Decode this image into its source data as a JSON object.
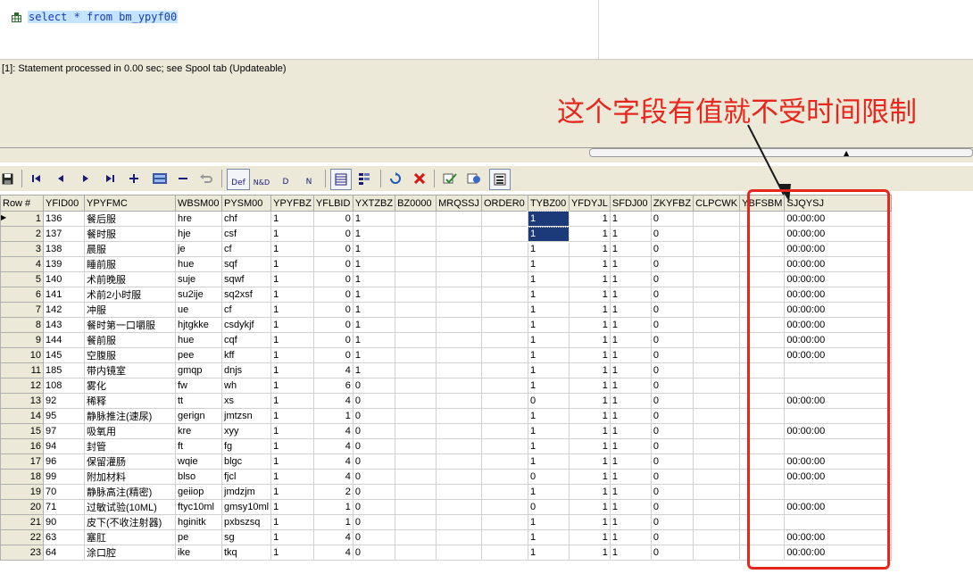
{
  "editor": {
    "sql": "select * from bm_ypyf00"
  },
  "output": {
    "message": "[1]: Statement processed in 0.00 sec; see Spool tab (Updateable)"
  },
  "toolbar": {
    "def_label": "Def",
    "nd_label": "N&D",
    "d_label": "D",
    "n_label": "N"
  },
  "annotation": {
    "text": "这个字段有值就不受时间限制",
    "color": "#e8261e"
  },
  "grid": {
    "columns": [
      "Row #",
      "YFID00",
      "YPYFMC",
      "WBSM00",
      "PYSM00",
      "YPYFBZ",
      "YFLBID",
      "YXTZBZ",
      "BZ0000",
      "MRQSSJ",
      "ORDER0",
      "TYBZ00",
      "YFDYJL",
      "SFDJ00",
      "ZKYFBZ",
      "CLPCWK",
      "YBFSBM",
      "SJQYSJ"
    ],
    "rows": [
      [
        "1",
        "136",
        "餐后服",
        "hre",
        "chf",
        "1",
        "0",
        "1",
        "",
        "",
        "",
        "1",
        "1",
        "1",
        "0",
        "",
        "",
        "00:00:00"
      ],
      [
        "2",
        "137",
        "餐时服",
        "hje",
        "csf",
        "1",
        "0",
        "1",
        "",
        "",
        "",
        "1",
        "1",
        "1",
        "0",
        "",
        "",
        "00:00:00"
      ],
      [
        "3",
        "138",
        "晨服",
        "je",
        "cf",
        "1",
        "0",
        "1",
        "",
        "",
        "",
        "1",
        "1",
        "1",
        "0",
        "",
        "",
        "00:00:00"
      ],
      [
        "4",
        "139",
        "睡前服",
        "hue",
        "sqf",
        "1",
        "0",
        "1",
        "",
        "",
        "",
        "1",
        "1",
        "1",
        "0",
        "",
        "",
        "00:00:00"
      ],
      [
        "5",
        "140",
        "术前晚服",
        "suje",
        "sqwf",
        "1",
        "0",
        "1",
        "",
        "",
        "",
        "1",
        "1",
        "1",
        "0",
        "",
        "",
        "00:00:00"
      ],
      [
        "6",
        "141",
        "术前2小时服",
        "su2ije",
        "sq2xsf",
        "1",
        "0",
        "1",
        "",
        "",
        "",
        "1",
        "1",
        "1",
        "0",
        "",
        "",
        "00:00:00"
      ],
      [
        "7",
        "142",
        "冲服",
        "ue",
        "cf",
        "1",
        "0",
        "1",
        "",
        "",
        "",
        "1",
        "1",
        "1",
        "0",
        "",
        "",
        "00:00:00"
      ],
      [
        "8",
        "143",
        "餐时第一口嚼服",
        "hjtgkke",
        "csdykjf",
        "1",
        "0",
        "1",
        "",
        "",
        "",
        "1",
        "1",
        "1",
        "0",
        "",
        "",
        "00:00:00"
      ],
      [
        "9",
        "144",
        "餐前服",
        "hue",
        "cqf",
        "1",
        "0",
        "1",
        "",
        "",
        "",
        "1",
        "1",
        "1",
        "0",
        "",
        "",
        "00:00:00"
      ],
      [
        "10",
        "145",
        "空腹服",
        "pee",
        "kff",
        "1",
        "0",
        "1",
        "",
        "",
        "",
        "1",
        "1",
        "1",
        "0",
        "",
        "",
        "00:00:00"
      ],
      [
        "11",
        "185",
        "带内镜室",
        "gmqp",
        "dnjs",
        "1",
        "4",
        "1",
        "",
        "",
        "",
        "1",
        "1",
        "1",
        "0",
        "",
        "",
        ""
      ],
      [
        "12",
        "108",
        "雾化",
        "fw",
        "wh",
        "1",
        "6",
        "0",
        "",
        "",
        "",
        "1",
        "1",
        "1",
        "0",
        "",
        "",
        ""
      ],
      [
        "13",
        "92",
        "稀释",
        "tt",
        "xs",
        "1",
        "4",
        "0",
        "",
        "",
        "",
        "0",
        "1",
        "1",
        "0",
        "",
        "",
        "00:00:00"
      ],
      [
        "14",
        "95",
        "静脉推注(速尿)",
        "gerign",
        "jmtzsn",
        "1",
        "1",
        "0",
        "",
        "",
        "",
        "1",
        "1",
        "1",
        "0",
        "",
        "",
        ""
      ],
      [
        "15",
        "97",
        "吸氧用",
        "kre",
        "xyy",
        "1",
        "4",
        "0",
        "",
        "",
        "",
        "1",
        "1",
        "1",
        "0",
        "",
        "",
        "00:00:00"
      ],
      [
        "16",
        "94",
        "封管",
        "ft",
        "fg",
        "1",
        "4",
        "0",
        "",
        "",
        "",
        "1",
        "1",
        "1",
        "0",
        "",
        "",
        ""
      ],
      [
        "17",
        "96",
        "保留灌肠",
        "wqie",
        "blgc",
        "1",
        "4",
        "0",
        "",
        "",
        "",
        "1",
        "1",
        "1",
        "0",
        "",
        "",
        "00:00:00"
      ],
      [
        "18",
        "99",
        "附加材料",
        "blso",
        "fjcl",
        "1",
        "4",
        "0",
        "",
        "",
        "",
        "0",
        "1",
        "1",
        "0",
        "",
        "",
        "00:00:00"
      ],
      [
        "19",
        "70",
        "静脉高注(精密)",
        "geiiop",
        "jmdzjm",
        "1",
        "2",
        "0",
        "",
        "",
        "",
        "1",
        "1",
        "1",
        "0",
        "",
        "",
        ""
      ],
      [
        "20",
        "71",
        "过敏试验(10ML)",
        "ftyc10ml",
        "gmsy10ml",
        "1",
        "1",
        "0",
        "",
        "",
        "",
        "0",
        "1",
        "1",
        "0",
        "",
        "",
        "00:00:00"
      ],
      [
        "21",
        "90",
        "皮下(不收注射器)",
        "hginitk",
        "pxbszsq",
        "1",
        "1",
        "0",
        "",
        "",
        "",
        "1",
        "1",
        "1",
        "0",
        "",
        "",
        ""
      ],
      [
        "22",
        "63",
        "塞肛",
        "pe",
        "sg",
        "1",
        "4",
        "0",
        "",
        "",
        "",
        "1",
        "1",
        "1",
        "0",
        "",
        "",
        "00:00:00"
      ],
      [
        "23",
        "64",
        "涂口腔",
        "ike",
        "tkq",
        "1",
        "4",
        "0",
        "",
        "",
        "",
        "1",
        "1",
        "1",
        "0",
        "",
        "",
        "00:00:00"
      ]
    ]
  }
}
